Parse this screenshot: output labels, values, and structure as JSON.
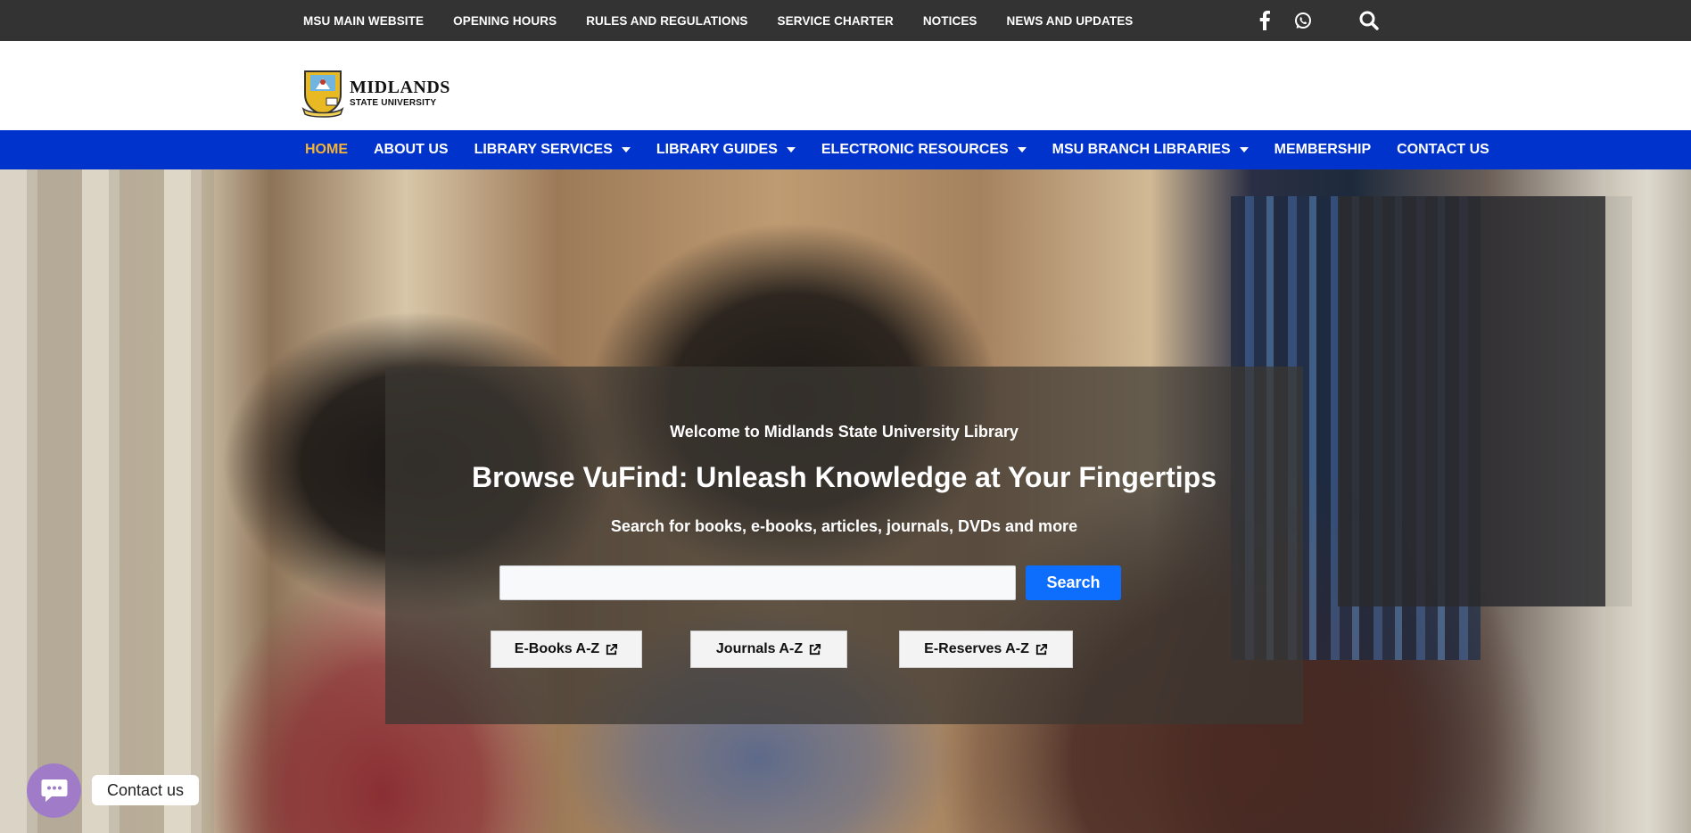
{
  "topbar": {
    "links": [
      "MSU MAIN WEBSITE",
      "OPENING HOURS",
      "RULES AND REGULATIONS",
      "SERVICE CHARTER",
      "NOTICES",
      "NEWS AND UPDATES"
    ],
    "icons": [
      "facebook-icon",
      "whatsapp-icon",
      "search-icon"
    ]
  },
  "logo": {
    "name": "MIDLANDS",
    "subtitle": "STATE UNIVERSITY"
  },
  "nav": {
    "items": [
      {
        "label": "HOME",
        "active": true,
        "dropdown": false
      },
      {
        "label": "ABOUT US",
        "active": false,
        "dropdown": false
      },
      {
        "label": "LIBRARY SERVICES",
        "active": false,
        "dropdown": true
      },
      {
        "label": "LIBRARY GUIDES",
        "active": false,
        "dropdown": true
      },
      {
        "label": "ELECTRONIC RESOURCES",
        "active": false,
        "dropdown": true
      },
      {
        "label": "MSU BRANCH LIBRARIES",
        "active": false,
        "dropdown": true
      },
      {
        "label": "MEMBERSHIP",
        "active": false,
        "dropdown": false
      },
      {
        "label": "CONTACT US",
        "active": false,
        "dropdown": false
      }
    ]
  },
  "hero": {
    "welcome": "Welcome to Midlands State University Library",
    "title": "Browse VuFind: Unleash Knowledge at Your Fingertips",
    "subtitle": "Search for books, e-books, articles, journals, DVDs and more",
    "search_value": "",
    "search_button": "Search",
    "az_buttons": [
      "E-Books A-Z",
      "Journals A-Z",
      "E-Reserves A-Z"
    ]
  },
  "contact": {
    "label": "Contact us"
  },
  "colors": {
    "topbar": "#333333",
    "nav": "#0033cc",
    "nav_active": "#f5b333",
    "search_button": "#0d6efd",
    "contact_bubble": "#a07cc8"
  }
}
